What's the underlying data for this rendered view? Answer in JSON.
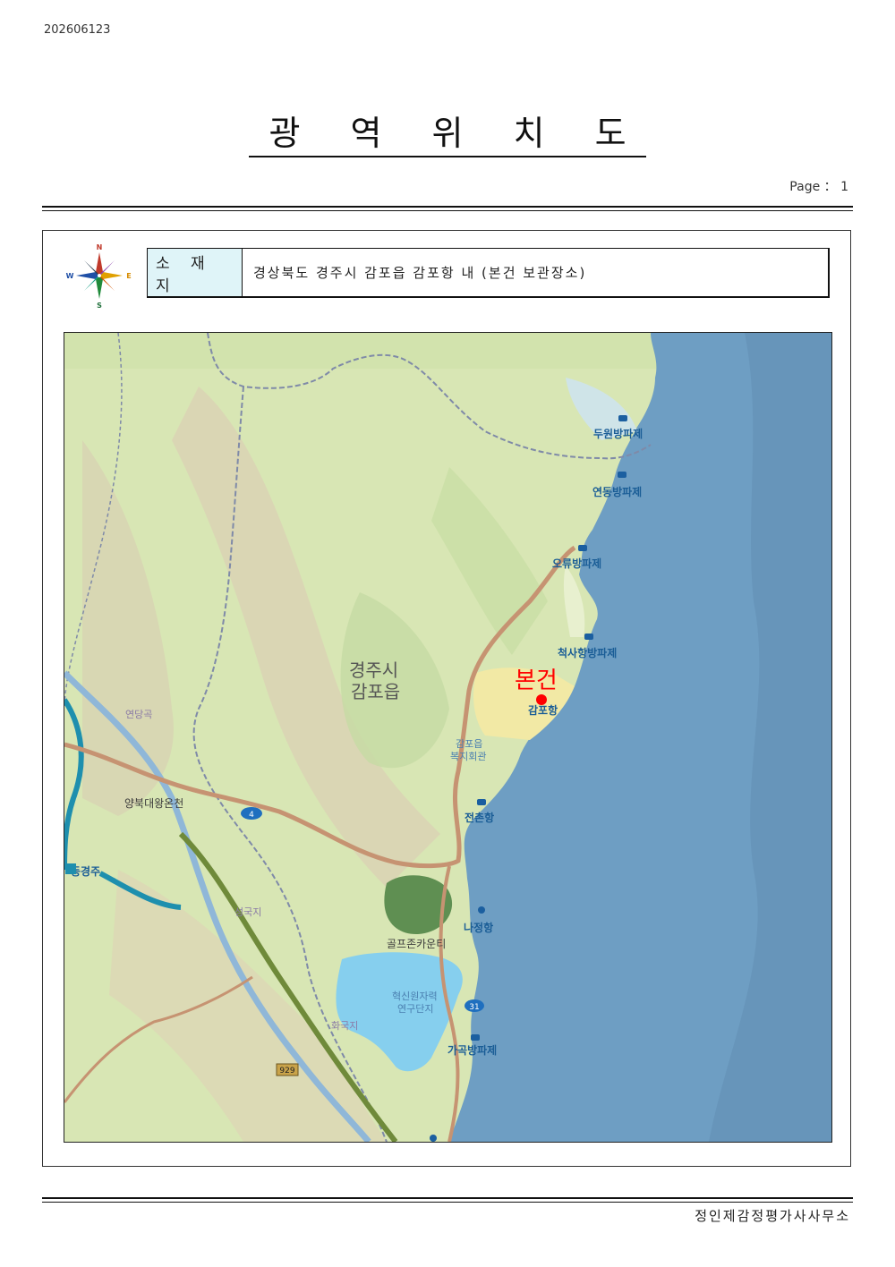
{
  "doc_number": "202606123",
  "title": "광 역 위 치 도",
  "page_label": "Page ： 1",
  "compass": {
    "n": "N",
    "s": "S",
    "e": "E",
    "w": "W"
  },
  "location": {
    "label": "소 재 지",
    "value": "경상북도 경주시 감포읍 감포항 내 (본건 보관장소)"
  },
  "map": {
    "marker_label": "본건",
    "marker_color": "#ff0000",
    "region_line1": "경주시",
    "region_line2": "감포읍",
    "places": {
      "duwon": "두원방파제",
      "yeondong": "연동방파제",
      "oryu": "오류방파제",
      "cheoksa": "척사항방파제",
      "gampo_port": "감포항",
      "welfare1": "감포읍",
      "welfare2": "복지회관",
      "jeonchon": "전촌항",
      "najeong": "나정항",
      "golf": "골프존카운티",
      "research1": "혁신원자력",
      "research2": "연구단지",
      "gagok": "가곡방파제",
      "yangbuk": "양북대왕온천",
      "yeondang": "연당곡",
      "donggyeongju": "동경주",
      "seongguk": "성국지",
      "hwaguk": "화국지"
    },
    "routes": {
      "r4": "4",
      "r31": "31",
      "r929": "929"
    },
    "colors": {
      "sea": "#6e9ec3",
      "land": "#d6e6b0",
      "road": "#c69372",
      "highway": "#1e8fae"
    }
  },
  "footer_org": "정인제감정평가사사무소"
}
